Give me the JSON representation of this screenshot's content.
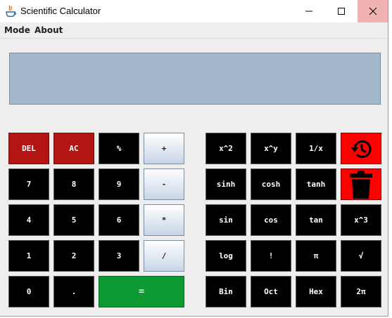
{
  "window": {
    "title": "Scientific Calculator"
  },
  "menu": {
    "items": [
      "Mode",
      "About"
    ]
  },
  "display": {
    "value": ""
  },
  "colors": {
    "display_bg": "#a3b8cc",
    "key_dark": "#000000",
    "key_red": "#b31414",
    "key_equals": "#0e9a33",
    "key_bright_red": "#ff0000"
  },
  "basic_keys": {
    "del": "DEL",
    "ac": "AC",
    "percent": "%",
    "plus": "+",
    "seven": "7",
    "eight": "8",
    "nine": "9",
    "minus": "-",
    "four": "4",
    "five": "5",
    "six": "6",
    "multiply": "*",
    "one": "1",
    "two": "2",
    "three": "3",
    "divide": "/",
    "zero": "0",
    "dot": ".",
    "equals": "="
  },
  "sci_keys": {
    "square": "x^2",
    "power": "x^y",
    "reciprocal": "1/x",
    "history_icon": "history-icon",
    "sinh": "sinh",
    "cosh": "cosh",
    "tanh": "tanh",
    "trash_icon": "trash-icon",
    "sin": "sin",
    "cos": "cos",
    "tan": "tan",
    "cube": "x^3",
    "log": "log",
    "factorial": "!",
    "pi": "π",
    "sqrt": "√",
    "bin": "Bin",
    "oct": "Oct",
    "hex": "Hex",
    "two_pi": "2π"
  }
}
